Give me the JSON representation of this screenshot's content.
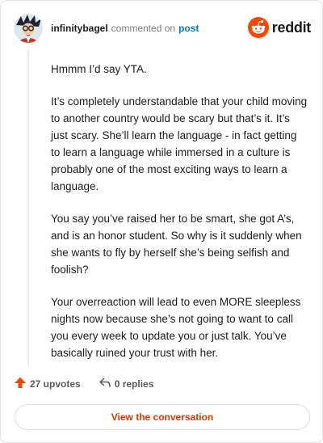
{
  "comment": {
    "username": "infinitybagel",
    "action_text": "commented on",
    "post_link": "post",
    "paragraphs": [
      "Hmmm I’d say YTA.",
      "It’s completely understandable that your child moving to another country would be scary but that’s it. It’s just scary. She’ll learn the language - in fact getting to learn a language while immersed in a culture is probably one of the most exciting ways to learn a language.",
      "You say you’ve raised her to be smart, she got A’s, and is an honor student. So why is it suddenly when she wants to fly by herself she’s being selfish and foolish?",
      "Your overreaction will lead to even MORE sleepless nights now because she’s not going to want to call you every week to update you or just talk. You’ve basically ruined your trust with her."
    ]
  },
  "brand": {
    "name": "reddit",
    "color": "#ff4500",
    "logo_icon": "reddit-snoo-icon"
  },
  "actions": {
    "upvotes": "27 upvotes",
    "replies": "0 replies",
    "upvote_icon": "upvote-arrow-icon",
    "reply_icon": "reply-arrow-icon",
    "upvote_color": "#ff4500"
  },
  "cta": {
    "label": "View the conversation",
    "color": "#d93a00"
  }
}
